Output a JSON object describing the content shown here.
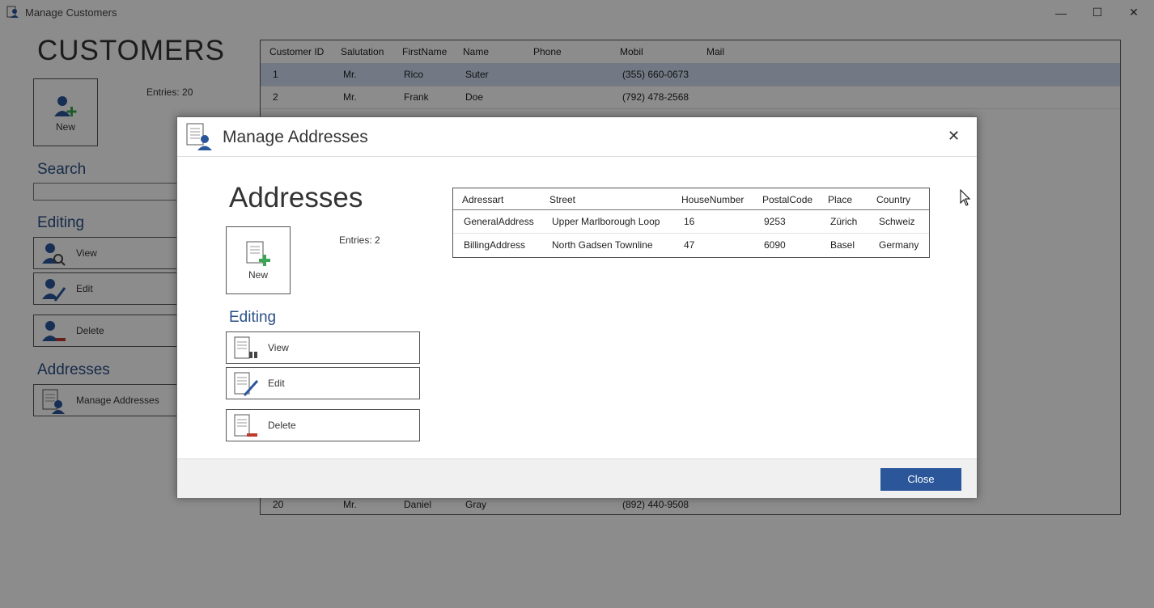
{
  "window": {
    "title": "Manage Customers",
    "minimize_glyph": "—",
    "maximize_glyph": "☐",
    "close_glyph": "✕"
  },
  "customers": {
    "title": "CUSTOMERS",
    "entries": "Entries: 20",
    "new_label": "New",
    "search_heading": "Search",
    "search_value": "",
    "editing_heading": "Editing",
    "view_label": "View",
    "edit_label": "Edit",
    "delete_label": "Delete",
    "addresses_heading": "Addresses",
    "manage_addresses_label": "Manage Addresses",
    "columns": [
      "Customer ID",
      "Salutation",
      "FirstName",
      "Name",
      "Phone",
      "Mobil",
      "Mail"
    ],
    "rows": [
      {
        "id": "1",
        "salutation": "Mr.",
        "first": "Rico",
        "name": "Suter",
        "phone": "",
        "mobil": "(355) 660-0673",
        "mail": ""
      },
      {
        "id": "2",
        "salutation": "Mr.",
        "first": "Frank",
        "name": "Doe",
        "phone": "",
        "mobil": "(792) 478-2568",
        "mail": ""
      },
      {
        "id": "20",
        "salutation": "Mr.",
        "first": "Daniel",
        "name": "Gray",
        "phone": "",
        "mobil": "(892) 440-9508",
        "mail": ""
      }
    ]
  },
  "dialog": {
    "title": "Manage Addresses",
    "close_glyph": "✕",
    "heading": "Addresses",
    "entries": "Entries: 2",
    "new_label": "New",
    "editing_heading": "Editing",
    "view_label": "View",
    "edit_label": "Edit",
    "delete_label": "Delete",
    "close_button": "Close",
    "columns": [
      "Adressart",
      "Street",
      "HouseNumber",
      "PostalCode",
      "Place",
      "Country"
    ],
    "rows": [
      {
        "type": "GeneralAddress",
        "street": "Upper Marlborough Loop",
        "house": "16",
        "postal": "9253",
        "place": "Zürich",
        "country": "Schweiz"
      },
      {
        "type": "BillingAddress",
        "street": "North Gadsen Townline",
        "house": "47",
        "postal": "6090",
        "place": "Basel",
        "country": "Germany"
      }
    ]
  },
  "colors": {
    "accent": "#2b579a",
    "heading": "#2b4f87",
    "selection": "#cfdcf0"
  }
}
